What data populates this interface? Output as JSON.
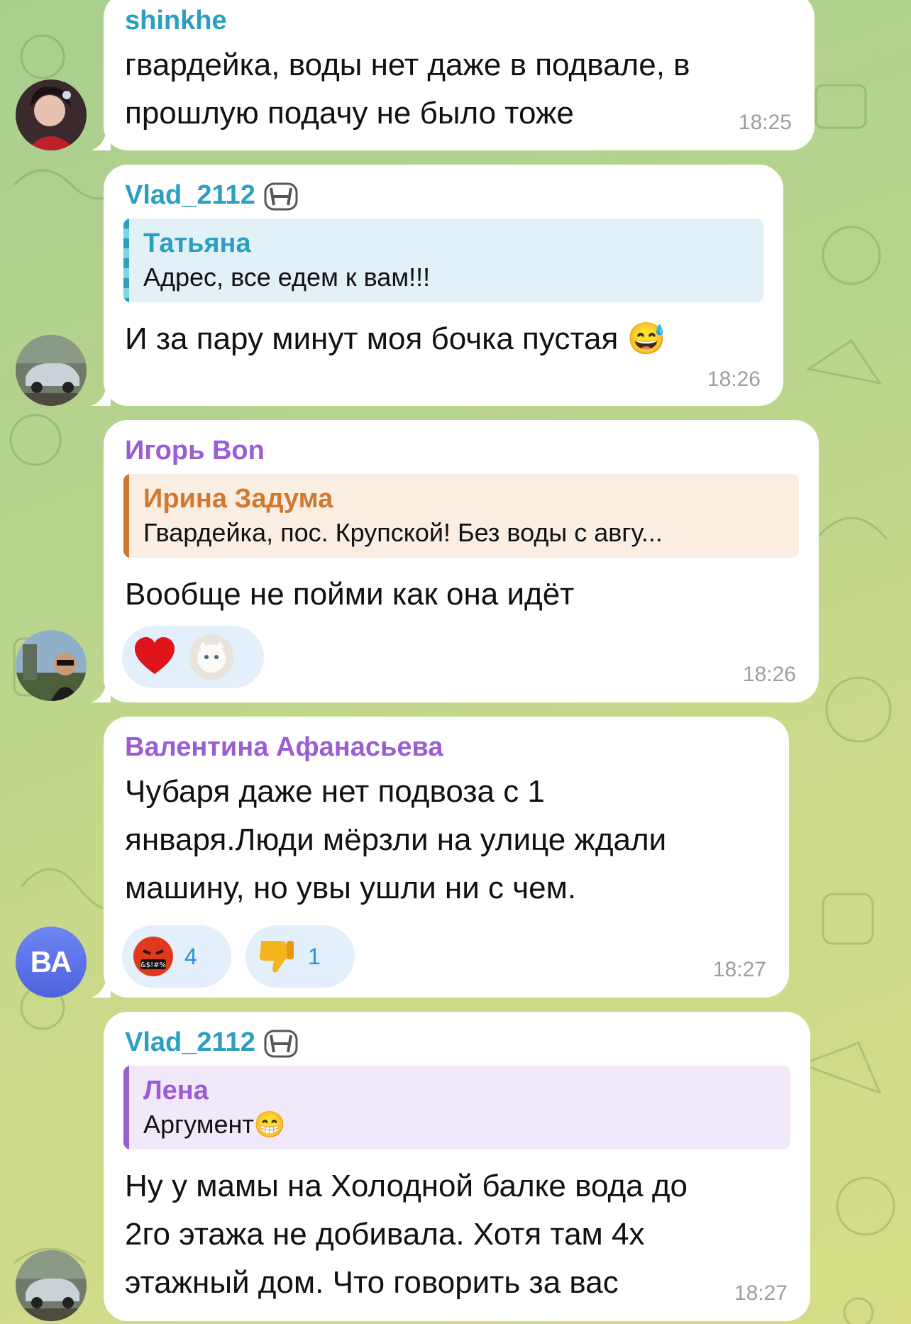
{
  "colors": {
    "teal": "#2a9fc0",
    "purple": "#9a5dd4",
    "orange": "#d2782e",
    "time": "#9aa0a0",
    "reaction_bg": "#e3f0fb",
    "reaction_count": "#2b8fd6"
  },
  "messages": [
    {
      "sender": "shinkhe",
      "text": "гвардейка, воды нет даже в подвале, в прошлую подачу не было тоже",
      "time": "18:25",
      "avatar": "avatar-photo-woman"
    },
    {
      "sender": "Vlad_2112",
      "sender_badge": "honda-logo-icon",
      "reply": {
        "name": "Татьяна",
        "text": "Адрес, все едем к вам!!!"
      },
      "text": "И за пару минут моя бочка пустая 😅",
      "time": "18:26",
      "avatar": "avatar-photo-car"
    },
    {
      "sender": "Игорь Bon",
      "reply": {
        "name": "Ирина Задума",
        "text": "Гвардейка, пос. Крупской! Без воды с авгу..."
      },
      "text": "Вообще не пойми как она идёт",
      "reactions": [
        {
          "emoji": "heart-icon"
        },
        {
          "emoji": "white-cat-avatar"
        }
      ],
      "time": "18:26",
      "avatar": "avatar-photo-man"
    },
    {
      "sender": "Валентина Афанасьева",
      "text_lines": [
        "Чубаря даже нет подвоза с 1",
        "января.Люди мёрзли на улице ждали",
        "машину, но увы ушли ни с чем."
      ],
      "reactions": [
        {
          "emoji": "cursing-face-icon",
          "count": "4"
        },
        {
          "emoji": "thumbs-down-icon",
          "count": "1"
        }
      ],
      "time": "18:27",
      "avatar_initials": "ВА"
    },
    {
      "sender": "Vlad_2112",
      "sender_badge": "honda-logo-icon",
      "reply": {
        "name": "Лена",
        "text": "Аргумент😁"
      },
      "text_lines": [
        "Ну у мамы на Холодной балке вода до",
        "2го этажа не добивала. Хотя там 4х",
        "этажный дом. Что говорить за вас"
      ],
      "time": "18:27",
      "avatar": "avatar-photo-car"
    }
  ]
}
